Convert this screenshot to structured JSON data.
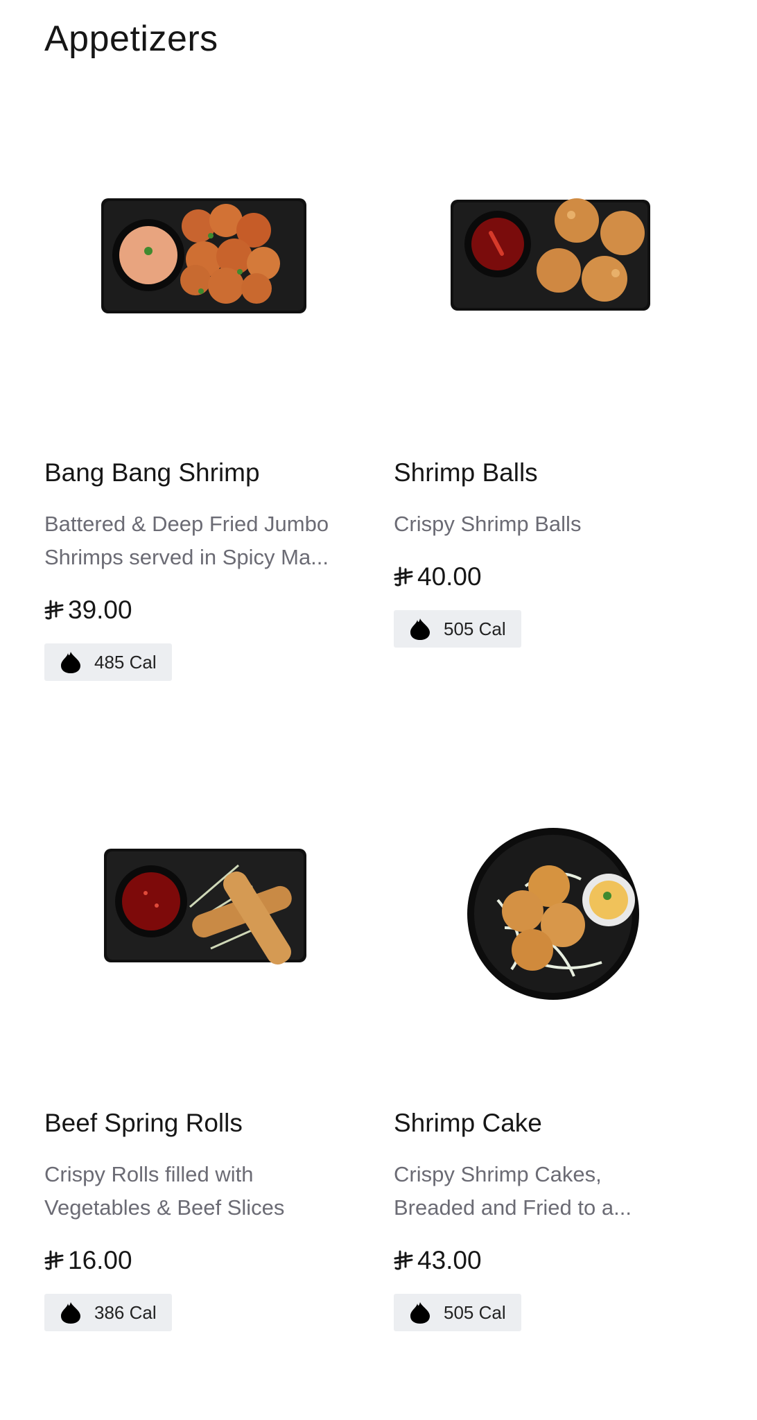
{
  "section": {
    "title": "Appetizers"
  },
  "currency_icon": "riyal-icon",
  "calorie_icon": "flame-drop-icon",
  "items": [
    {
      "name": "Bang Bang Shrimp",
      "desc_line1": "Battered & Deep Fried Jumbo",
      "desc_line2": "Shrimps served in Spicy Ma...",
      "price": "39.00",
      "calories": "485 Cal",
      "image": "plate-of-fried-shrimp-with-dip"
    },
    {
      "name": "Shrimp Balls",
      "desc_line1": "Crispy Shrimp Balls",
      "desc_line2": "",
      "price": "40.00",
      "calories": "505 Cal",
      "image": "plate-of-shrimp-balls-with-chili-sauce"
    },
    {
      "name": "Beef Spring Rolls",
      "desc_line1": "Crispy Rolls filled with",
      "desc_line2": "Vegetables & Beef Slices",
      "price": "16.00",
      "calories": "386 Cal",
      "image": "plate-of-spring-rolls-with-sweet-chili"
    },
    {
      "name": "Shrimp Cake",
      "desc_line1": "Crispy Shrimp Cakes,",
      "desc_line2": "Breaded and Fried to a...",
      "price": "43.00",
      "calories": "505 Cal",
      "image": "round-plate-of-shrimp-cakes"
    }
  ],
  "colors": {
    "text": "#161616",
    "muted": "#6b6b74",
    "badge_bg": "#eceef1",
    "plate": "#141414"
  }
}
